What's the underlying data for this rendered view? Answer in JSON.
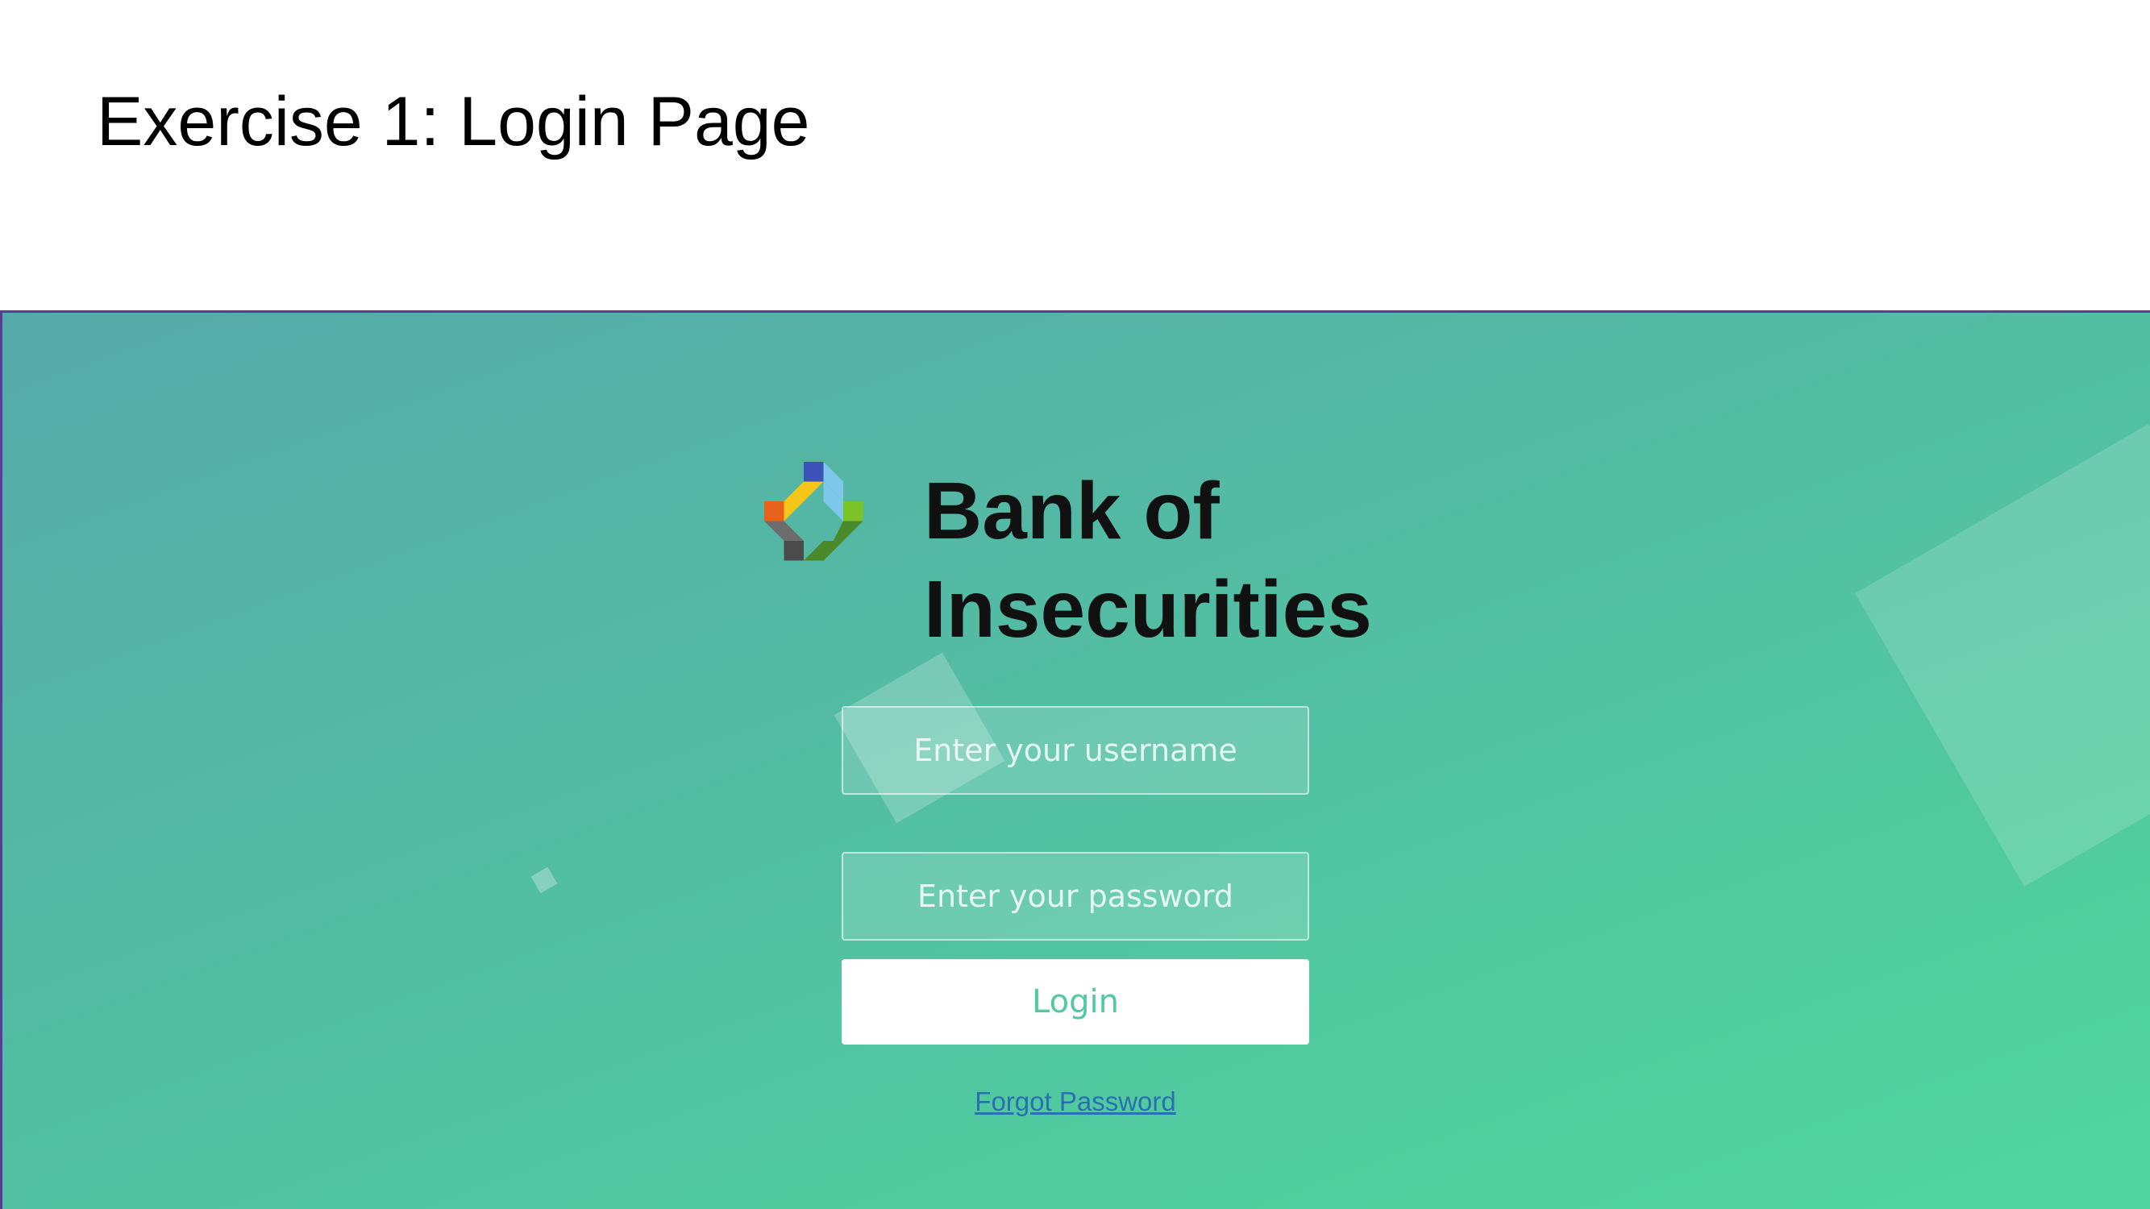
{
  "slide": {
    "title": "Exercise 1: Login Page"
  },
  "login_page": {
    "brand": {
      "name_line1": "Bank of",
      "name_line2": "Insecurities",
      "logo_colors": [
        "#e8611a",
        "#f5c518",
        "#3a53b8",
        "#7cc7ea",
        "#7cc32a",
        "#4a8a2a",
        "#4b4b4b",
        "#6d6d6d"
      ]
    },
    "username": {
      "placeholder": "Enter your username",
      "value": ""
    },
    "password": {
      "placeholder": "Enter your password",
      "value": ""
    },
    "login_label": "Login",
    "forgot_password_label": "Forgot Password",
    "colors": {
      "background_start": "#56a9a9",
      "background_end": "#51d6a1",
      "accent": "#52c9a0",
      "link": "#2a6fb0",
      "frame_border": "#5a3c96"
    }
  }
}
